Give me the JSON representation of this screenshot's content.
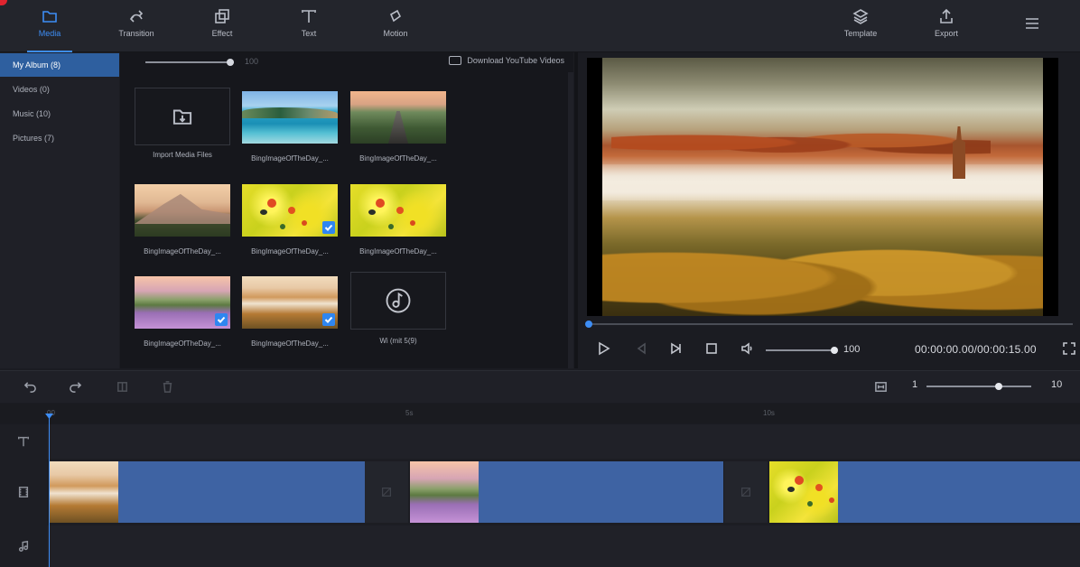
{
  "toolbar": {
    "media": "Media",
    "transition": "Transition",
    "effect": "Effect",
    "text": "Text",
    "motion": "Motion",
    "template": "Template",
    "export": "Export"
  },
  "album": {
    "items": [
      {
        "label": "My Album  (8)"
      },
      {
        "label": "Videos  (0)"
      },
      {
        "label": "Music  (10)"
      },
      {
        "label": "Pictures  (7)"
      }
    ]
  },
  "media": {
    "zoom_value": "100",
    "download_label": "Download YouTube Videos",
    "import_label": "Import Media Files",
    "items": [
      {
        "caption": "BingImageOfTheDay_...",
        "checked": false,
        "image": "lake"
      },
      {
        "caption": "BingImageOfTheDay_...",
        "checked": false,
        "image": "road"
      },
      {
        "caption": "BingImageOfTheDay_...",
        "checked": false,
        "image": "mountain"
      },
      {
        "caption": "BingImageOfTheDay_...",
        "checked": true,
        "image": "yellow-flowers"
      },
      {
        "caption": "BingImageOfTheDay_...",
        "checked": false,
        "image": "yellow-flowers"
      },
      {
        "caption": "BingImageOfTheDay_...",
        "checked": true,
        "image": "lavender"
      },
      {
        "caption": "BingImageOfTheDay_...",
        "checked": true,
        "image": "foggy-vineyard"
      },
      {
        "caption": "Wi (mit 5(9)",
        "checked": false,
        "image": "music-note"
      }
    ]
  },
  "preview": {
    "volume": "100",
    "timecode": "00:00:00.00/00:00:15.00"
  },
  "timeline": {
    "zoom_min": "1",
    "zoom_max": "10",
    "zoom_level": 0.7,
    "ruler": [
      "00",
      "5s",
      "10s"
    ]
  },
  "colors": {
    "accent": "#3d8df5",
    "clip": "#3e63a3",
    "background": "#1b1c22"
  }
}
